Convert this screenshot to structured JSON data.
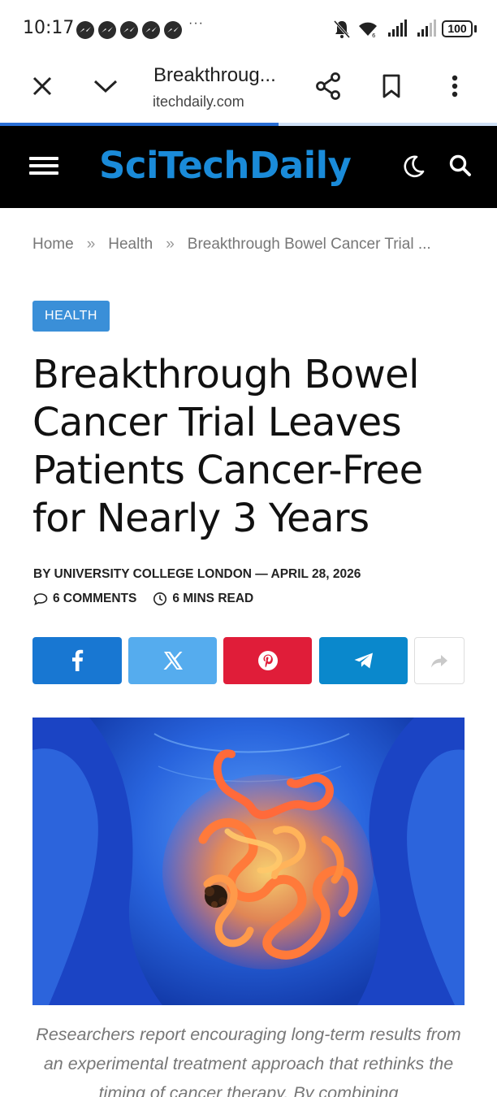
{
  "status_bar": {
    "time": "10:17",
    "more_indicator": "···",
    "battery": "100",
    "icons": [
      "messenger-icon",
      "messenger-icon",
      "messenger-icon",
      "messenger-icon",
      "messenger-icon",
      "bell-off-icon",
      "wifi-icon",
      "signal-icon",
      "signal-icon",
      "battery-icon"
    ]
  },
  "browser": {
    "page_title": "Breakthroug...",
    "url": "itechdaily.com",
    "load_progress": 0.56,
    "icons": [
      "close-icon",
      "chevron-down-icon",
      "share-icon",
      "bookmark-icon",
      "more-vert-icon"
    ],
    "progress_color": "#2a6fd6"
  },
  "site": {
    "logo_parts": [
      "Sci",
      "Tech",
      "Daily"
    ],
    "header_bg": "#000000",
    "logo_color": "#1a8bd9",
    "icons": [
      "menu-icon",
      "moon-icon",
      "search-icon"
    ]
  },
  "breadcrumb": {
    "items": [
      "Home",
      "Health",
      "Breakthrough Bowel Cancer Trial ..."
    ],
    "separator": "»"
  },
  "article": {
    "category": "HEALTH",
    "title": "Breakthrough Bowel Cancer Trial Leaves Patients Cancer-Free for Nearly 3 Years",
    "byline": "BY UNIVERSITY COLLEGE LONDON — APRIL 28, 2026",
    "comments": "6 COMMENTS",
    "read_time": "6 MINS READ",
    "caption": "Researchers report encouraging long-term results from an experimental treatment approach that rethinks the timing of cancer therapy. By combining"
  },
  "share": {
    "buttons": [
      {
        "name": "facebook",
        "icon": "facebook-icon",
        "color": "#1877d2"
      },
      {
        "name": "x",
        "icon": "x-icon",
        "color": "#55acee"
      },
      {
        "name": "pinterest",
        "icon": "pinterest-icon",
        "color": "#e01d39"
      },
      {
        "name": "telegram",
        "icon": "telegram-icon",
        "color": "#0a88cc"
      },
      {
        "name": "more",
        "icon": "forward-icon",
        "color": "#ffffff"
      }
    ]
  },
  "colors": {
    "badge": "#3a8fd8",
    "headline": "#111111",
    "meta": "#222222",
    "breadcrumb": "#777777"
  }
}
